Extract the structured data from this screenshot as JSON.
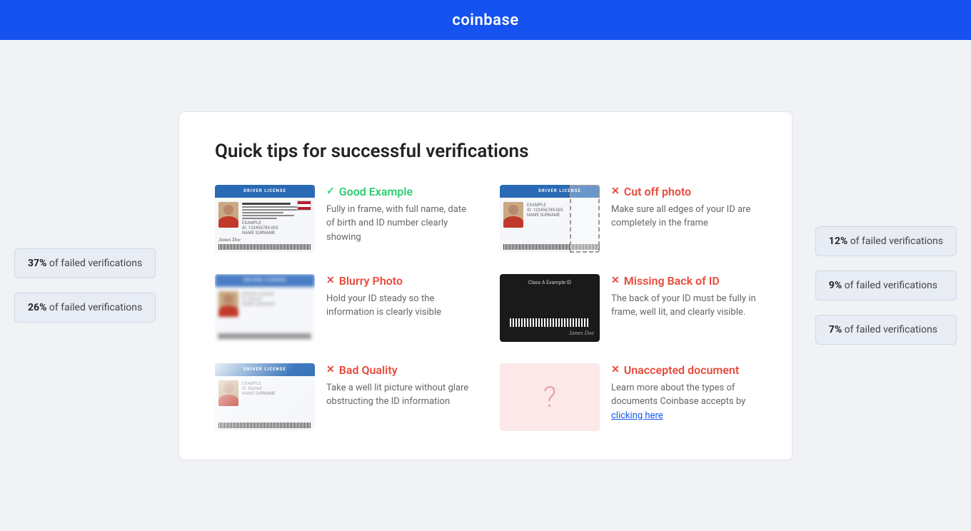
{
  "header": {
    "logo": "coinbase"
  },
  "side_badges_left": [
    {
      "percent": "37%",
      "label": "of failed verifications"
    },
    {
      "percent": "26%",
      "label": "of failed verifications"
    }
  ],
  "side_badges_right": [
    {
      "percent": "12%",
      "label": "of failed verifications"
    },
    {
      "percent": "9%",
      "label": "of failed verifications"
    },
    {
      "percent": "7%",
      "label": "of failed verifications"
    }
  ],
  "card": {
    "title": "Quick tips for successful verifications",
    "tips": [
      {
        "id": "good-example",
        "type": "good",
        "icon": "✓",
        "label": "Good Example",
        "description": "Fully in frame, with full name, date of birth and ID number clearly showing"
      },
      {
        "id": "cut-off-photo",
        "type": "bad",
        "icon": "✕",
        "label": "Cut off photo",
        "description": "Make sure all edges of your ID are completely in the frame"
      },
      {
        "id": "blurry-photo",
        "type": "bad",
        "icon": "✕",
        "label": "Blurry Photo",
        "description": "Hold your ID steady so the information is clearly visible"
      },
      {
        "id": "missing-back",
        "type": "bad",
        "icon": "✕",
        "label": "Missing Back of ID",
        "description": "The back of your ID must be fully in frame, well lit, and clearly visible."
      },
      {
        "id": "bad-quality",
        "type": "bad",
        "icon": "✕",
        "label": "Bad Quality",
        "description": "Take a well lit picture without glare obstructing the ID information"
      },
      {
        "id": "unaccepted-document",
        "type": "bad",
        "icon": "✕",
        "label": "Unaccepted document",
        "description": "Learn more about the types of documents Coinbase accepts by",
        "link_text": "clicking here",
        "link_href": "#"
      }
    ]
  }
}
